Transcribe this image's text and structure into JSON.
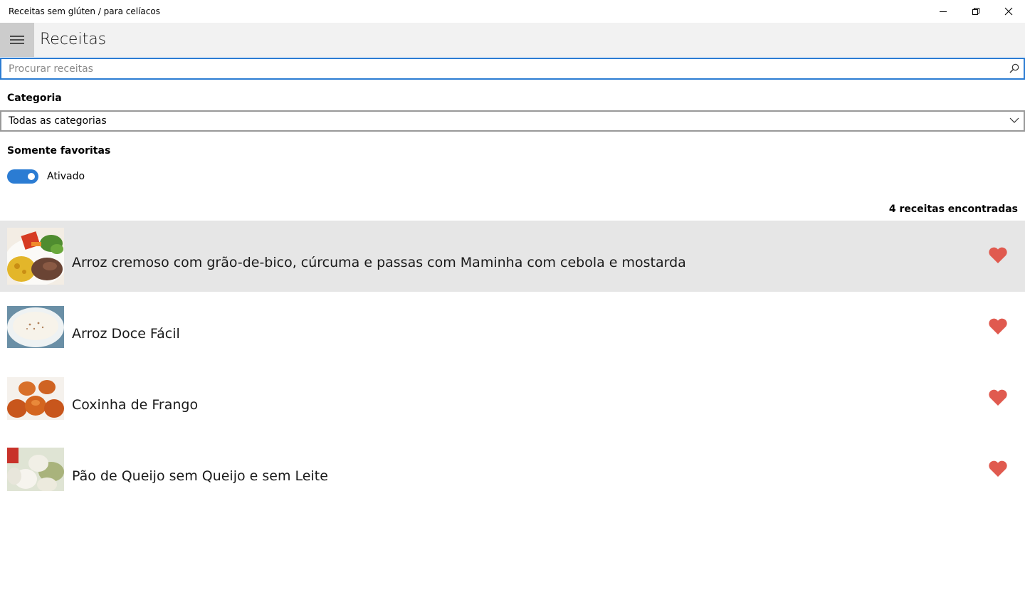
{
  "window": {
    "title": "Receitas sem glúten / para celíacos"
  },
  "header": {
    "title": "Receitas"
  },
  "search": {
    "placeholder": "Procurar receitas",
    "value": ""
  },
  "category": {
    "label": "Categoria",
    "selected": "Todas as categorias"
  },
  "favorites": {
    "label": "Somente favoritas",
    "toggle_state": "Ativado",
    "on": true
  },
  "results": {
    "count_text": "4 receitas encontradas"
  },
  "recipes": [
    {
      "title": "Arroz cremoso com grão-de-bico, cúrcuma e passas com Maminha com cebola e mostarda",
      "favorite": true
    },
    {
      "title": "Arroz Doce Fácil",
      "favorite": true
    },
    {
      "title": "Coxinha de Frango",
      "favorite": true
    },
    {
      "title": "Pão de Queijo sem Queijo e sem Leite",
      "favorite": true
    }
  ],
  "colors": {
    "accent": "#2b7cd3",
    "heart": "#e05a4f",
    "selected_row": "#e6e6e6",
    "header_bg": "#f2f2f2"
  }
}
